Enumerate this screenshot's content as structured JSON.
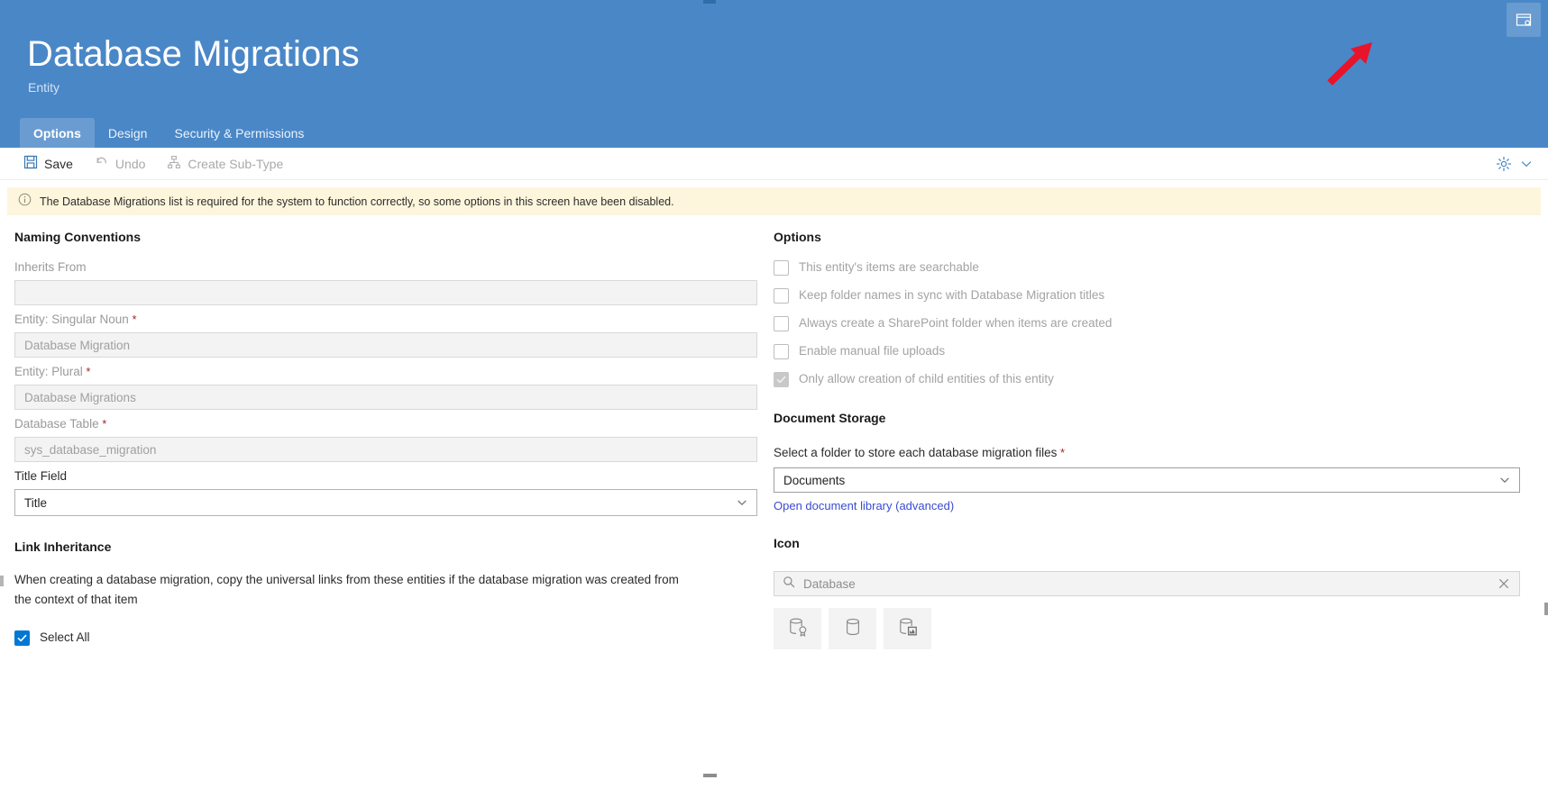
{
  "header": {
    "title": "Database Migrations",
    "subtitle": "Entity",
    "tabs": [
      {
        "label": "Options",
        "active": true
      },
      {
        "label": "Design",
        "active": false
      },
      {
        "label": "Security & Permissions",
        "active": false
      }
    ],
    "window_button_icon": "window-preview-icon",
    "accent_color": "#4a87c7",
    "annotation_arrow_color": "#e8142a"
  },
  "toolbar": {
    "save_label": "Save",
    "undo_label": "Undo",
    "create_subtype_label": "Create Sub-Type",
    "settings_icon": "gear-icon",
    "overflow_icon": "chevron-down-icon"
  },
  "notice": {
    "icon": "info-icon",
    "text": "The Database Migrations list is required for the system to function correctly, so some options in this screen have been disabled.",
    "background_color": "#fdf6dd"
  },
  "left": {
    "naming_heading": "Naming Conventions",
    "fields": [
      {
        "label": "Inherits From",
        "required": false,
        "value": "",
        "disabled": true
      },
      {
        "label": "Entity: Singular Noun",
        "required": true,
        "value": "Database Migration",
        "disabled": true
      },
      {
        "label": "Entity: Plural",
        "required": true,
        "value": "Database Migrations",
        "disabled": true
      },
      {
        "label": "Database Table",
        "required": true,
        "value": "sys_database_migration",
        "disabled": true
      }
    ],
    "title_field_label": "Title Field",
    "title_field_value": "Title",
    "link_inheritance_heading": "Link Inheritance",
    "link_inheritance_text": "When creating a database migration, copy the universal links from these entities if the database migration was created from the context of that item",
    "select_all_label": "Select All",
    "select_all_checked": true
  },
  "right": {
    "options_heading": "Options",
    "options": [
      {
        "label": "This entity's items are searchable",
        "checked": false,
        "disabled": true
      },
      {
        "label": "Keep folder names in sync with Database Migration titles",
        "checked": false,
        "disabled": true
      },
      {
        "label": "Always create a SharePoint folder when items are created",
        "checked": false,
        "disabled": true
      },
      {
        "label": "Enable manual file uploads",
        "checked": false,
        "disabled": true
      },
      {
        "label": "Only allow creation of child entities of this entity",
        "checked": true,
        "disabled": true
      }
    ],
    "doc_storage_heading": "Document Storage",
    "folder_label": "Select a folder to store each database migration files",
    "folder_required": true,
    "folder_value": "Documents",
    "open_library_link": "Open document library (advanced)",
    "icon_heading": "Icon",
    "icon_search_value": "Database",
    "icon_search_icon": "search-icon",
    "icon_clear_icon": "close-icon",
    "icon_results": [
      {
        "name": "database-badge-icon"
      },
      {
        "name": "database-icon"
      },
      {
        "name": "database-chart-icon"
      }
    ]
  }
}
